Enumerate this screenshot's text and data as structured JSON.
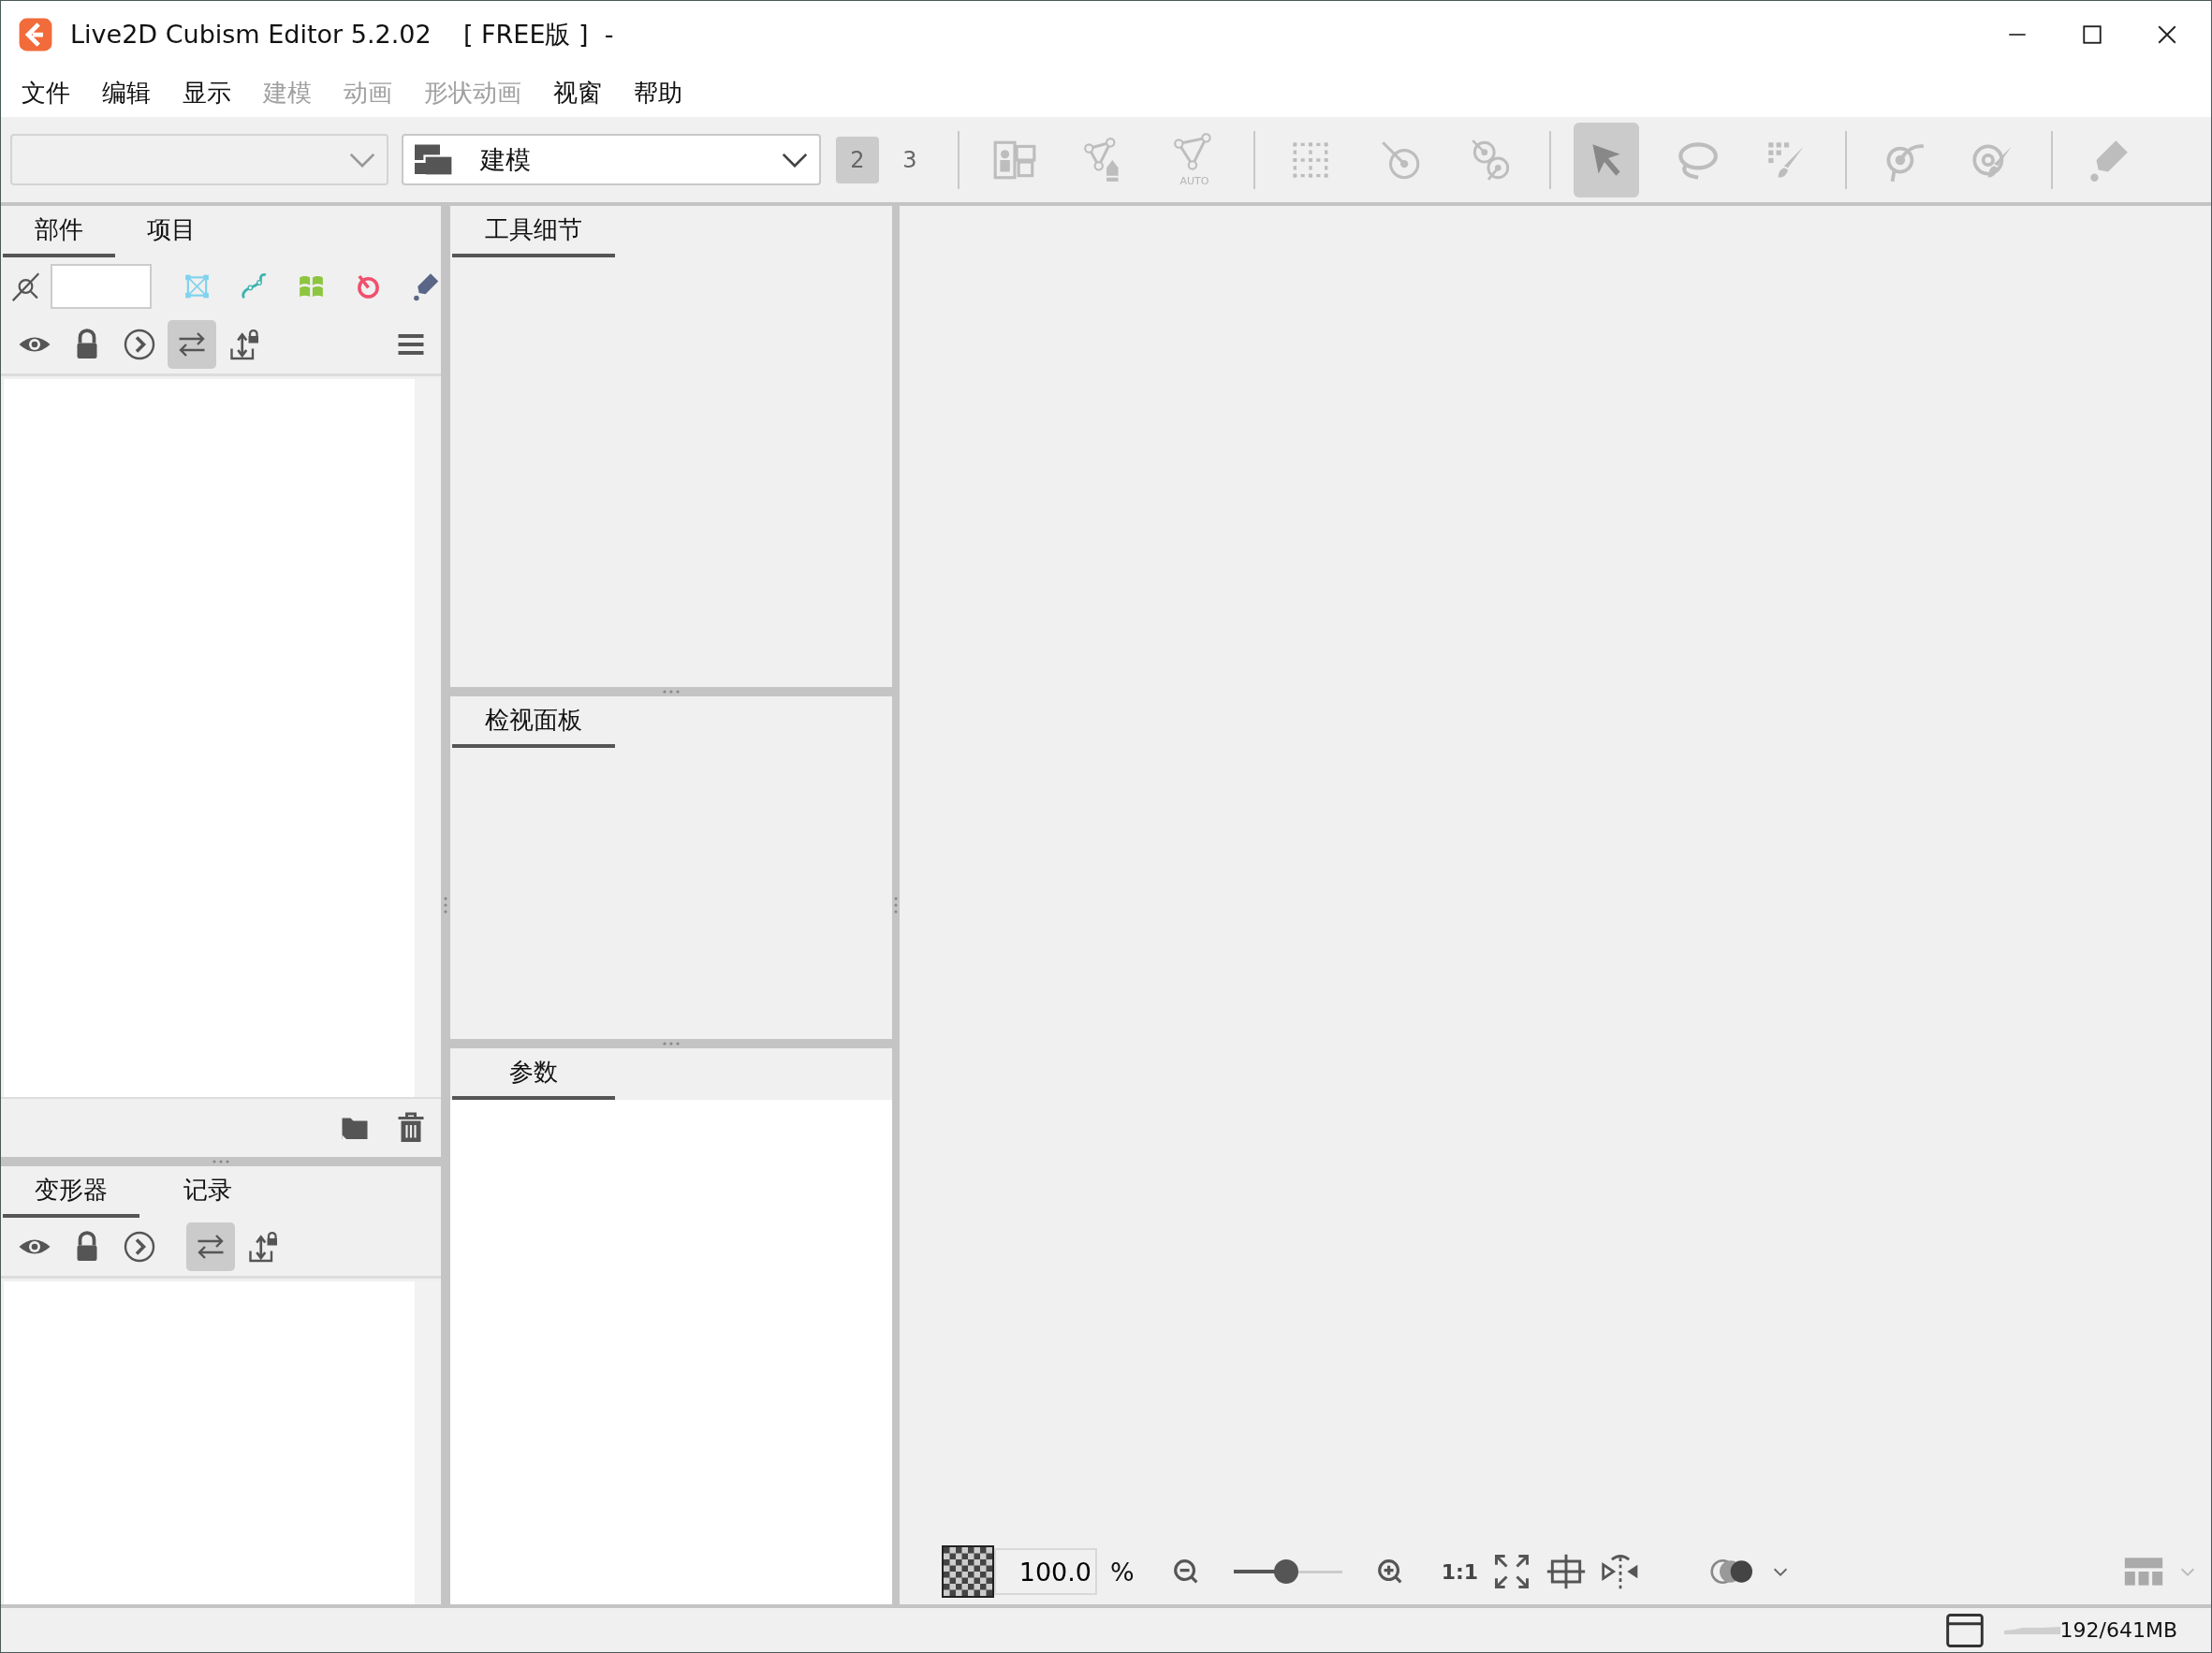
{
  "window": {
    "title": "Live2D Cubism Editor 5.2.02    [ FREE版 ]  -"
  },
  "menu": [
    {
      "label": "文件",
      "disabled": false
    },
    {
      "label": "编辑",
      "disabled": false
    },
    {
      "label": "显示",
      "disabled": false
    },
    {
      "label": "建模",
      "disabled": true
    },
    {
      "label": "动画",
      "disabled": true
    },
    {
      "label": "形状动画",
      "disabled": true
    },
    {
      "label": "视窗",
      "disabled": false
    },
    {
      "label": "帮助",
      "disabled": false
    }
  ],
  "toolbar": {
    "workspace_select": {
      "value": "建模"
    },
    "views": [
      {
        "label": "2",
        "selected": true
      },
      {
        "label": "3",
        "selected": false
      }
    ],
    "tool_groups": [
      [
        {
          "kind": "layout",
          "selected": false
        },
        {
          "kind": "mesh-pen",
          "selected": false
        },
        {
          "kind": "mesh-auto",
          "caption": "AUTO",
          "selected": false
        }
      ],
      [
        {
          "kind": "grid",
          "selected": false
        },
        {
          "kind": "pivot",
          "selected": false
        },
        {
          "kind": "pivot-pair",
          "selected": false
        }
      ],
      [
        {
          "kind": "arrow",
          "selected": true
        },
        {
          "kind": "lasso",
          "selected": false
        },
        {
          "kind": "dot-brush",
          "selected": false
        }
      ],
      [
        {
          "kind": "glue",
          "selected": false
        },
        {
          "kind": "target-brush",
          "selected": false
        }
      ],
      [
        {
          "kind": "pen",
          "selected": false
        }
      ]
    ]
  },
  "parts_panel": {
    "tabs": [
      {
        "label": "部件",
        "selected": true
      },
      {
        "label": "项目",
        "selected": false
      }
    ],
    "filter_tools": [
      {
        "kind": "art-mesh"
      },
      {
        "kind": "curve"
      },
      {
        "kind": "warp"
      },
      {
        "kind": "rotation"
      },
      {
        "kind": "blue-pen"
      }
    ],
    "view_toggles": [
      {
        "kind": "eye",
        "selected": false
      },
      {
        "kind": "lock",
        "selected": false
      },
      {
        "kind": "chevron",
        "selected": false
      },
      {
        "kind": "swap",
        "selected": true
      },
      {
        "kind": "export-lock",
        "selected": false
      }
    ]
  },
  "deformer_panel": {
    "tabs": [
      {
        "label": "变形器",
        "selected": true
      },
      {
        "label": "记录",
        "selected": false
      }
    ],
    "view_toggles": [
      {
        "kind": "eye",
        "selected": false
      },
      {
        "kind": "lock",
        "selected": false
      },
      {
        "kind": "chevron",
        "selected": false
      },
      {
        "kind": "swap",
        "selected": true
      },
      {
        "kind": "export-lock",
        "selected": false
      }
    ]
  },
  "panels": [
    {
      "title": "工具细节",
      "kind": "details"
    },
    {
      "title": "检视面板",
      "kind": "inspector"
    },
    {
      "title": "参数",
      "kind": "list"
    }
  ],
  "canvas_bar": {
    "zoom_value": "100.0",
    "zoom_unit": "%",
    "zoom": {
      "level": 0.49
    },
    "actual_size": "1:1"
  },
  "status_bar": {
    "memory": "192/641MB"
  }
}
